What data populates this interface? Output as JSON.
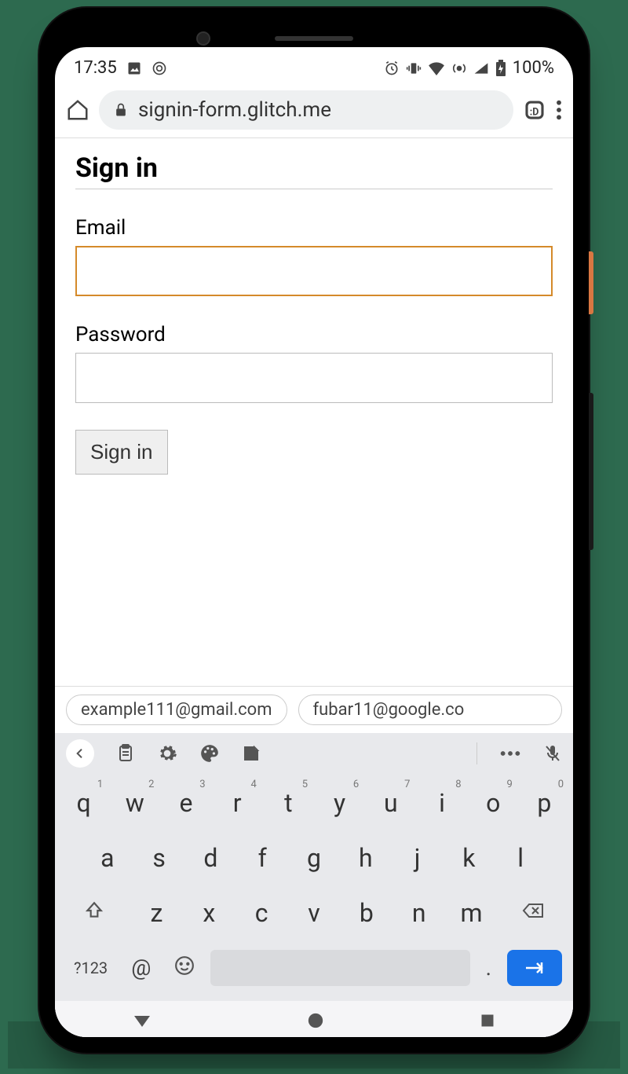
{
  "status": {
    "time": "17:35",
    "battery": "100%"
  },
  "browser": {
    "url": "signin-form.glitch.me"
  },
  "page": {
    "title": "Sign in",
    "email_label": "Email",
    "password_label": "Password",
    "signin_button": "Sign in"
  },
  "suggestions": [
    "example111@gmail.com",
    "fubar11@google.co"
  ],
  "keyboard": {
    "row1": [
      {
        "k": "q",
        "s": "1"
      },
      {
        "k": "w",
        "s": "2"
      },
      {
        "k": "e",
        "s": "3"
      },
      {
        "k": "r",
        "s": "4"
      },
      {
        "k": "t",
        "s": "5"
      },
      {
        "k": "y",
        "s": "6"
      },
      {
        "k": "u",
        "s": "7"
      },
      {
        "k": "i",
        "s": "8"
      },
      {
        "k": "o",
        "s": "9"
      },
      {
        "k": "p",
        "s": "0"
      }
    ],
    "row2": [
      "a",
      "s",
      "d",
      "f",
      "g",
      "h",
      "j",
      "k",
      "l"
    ],
    "row3": [
      "z",
      "x",
      "c",
      "v",
      "b",
      "n",
      "m"
    ],
    "sym": "?123",
    "at": "@",
    "period": "."
  }
}
